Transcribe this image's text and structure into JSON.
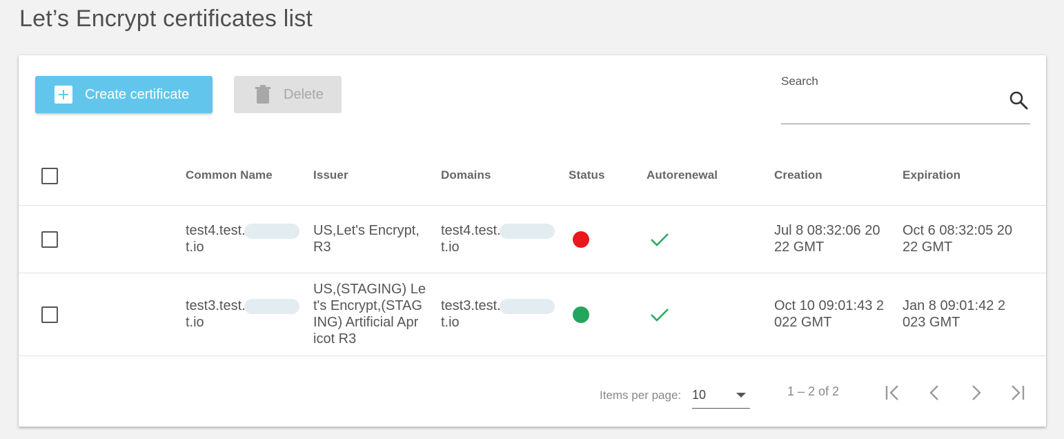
{
  "page": {
    "title": "Let’s Encrypt certificates list"
  },
  "toolbar": {
    "create_label": "Create certificate",
    "delete_label": "Delete"
  },
  "search": {
    "label": "Search",
    "value": ""
  },
  "table": {
    "columns": [
      "Common Name",
      "Issuer",
      "Domains",
      "Status",
      "Autorenewal",
      "Creation",
      "Expiration"
    ],
    "rows": [
      {
        "common_name_line1": "test4.test.",
        "common_name_line2": "t.io",
        "issuer_lines": [
          "US,Let's Encrypt,",
          "R3"
        ],
        "domains_line1": "test4.test.",
        "domains_line2": "t.io",
        "status_color": "#e8181d",
        "autorenewal": true,
        "creation_lines": [
          "Jul 8 08:32:06 20",
          "22 GMT"
        ],
        "expiration_lines": [
          "Oct 6 08:32:05 20",
          "22 GMT"
        ]
      },
      {
        "common_name_line1": "test3.test.",
        "common_name_line2": "t.io",
        "issuer_lines": [
          "US,(STAGING) Le",
          "t's Encrypt,(STAG",
          "ING) Artificial Apr",
          "icot R3"
        ],
        "domains_line1": "test3.test.",
        "domains_line2": "t.io",
        "status_color": "#23a55e",
        "autorenewal": true,
        "creation_lines": [
          "Oct 10 09:01:43 2",
          "022 GMT"
        ],
        "expiration_lines": [
          "Jan 8 09:01:42 2",
          "023 GMT"
        ]
      }
    ]
  },
  "paginator": {
    "items_per_page_label": "Items per page:",
    "page_size": "10",
    "range_label": "1 – 2 of 2"
  },
  "colors": {
    "accent": "#62c6ec",
    "check": "#2aa864"
  },
  "icons": [
    "plus-icon",
    "trash-icon",
    "search-icon",
    "check-icon",
    "first-page-icon",
    "previous-page-icon",
    "next-page-icon",
    "last-page-icon"
  ]
}
